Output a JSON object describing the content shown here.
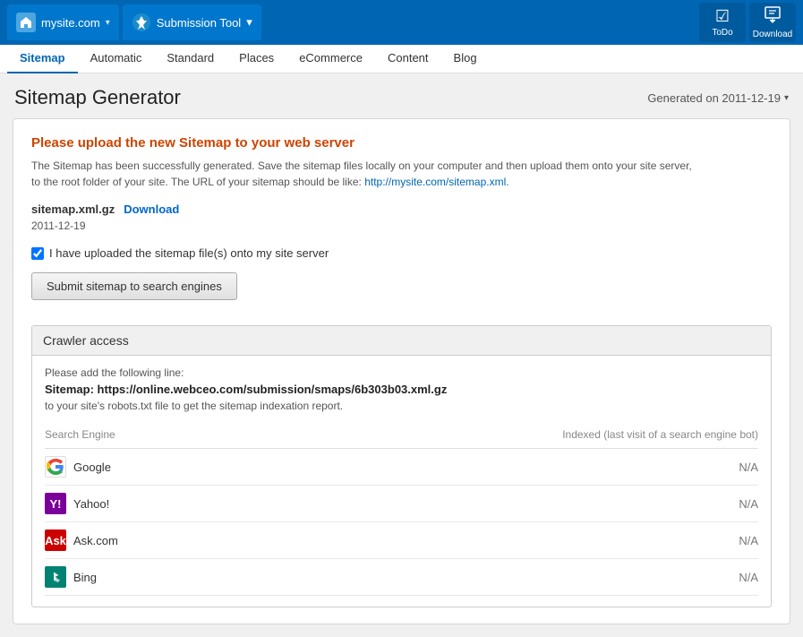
{
  "topbar": {
    "site": {
      "label": "mysite.com",
      "arrow": "▾"
    },
    "tool": {
      "label": "Submission Tool",
      "arrow": "▾"
    },
    "buttons": [
      {
        "id": "todo-btn",
        "label": "ToDo",
        "icon": "☑"
      },
      {
        "id": "download-btn",
        "label": "Download",
        "icon": "⬇"
      }
    ]
  },
  "secnav": {
    "tabs": [
      {
        "id": "sitemap",
        "label": "Sitemap",
        "active": true
      },
      {
        "id": "automatic",
        "label": "Automatic",
        "active": false
      },
      {
        "id": "standard",
        "label": "Standard",
        "active": false
      },
      {
        "id": "places",
        "label": "Places",
        "active": false
      },
      {
        "id": "ecommerce",
        "label": "eCommerce",
        "active": false
      },
      {
        "id": "content",
        "label": "Content",
        "active": false
      },
      {
        "id": "blog",
        "label": "Blog",
        "active": false
      }
    ]
  },
  "page": {
    "title": "Sitemap Generator",
    "generated": "Generated on 2011-12-19"
  },
  "alert": {
    "title": "Please upload the new Sitemap to your web server",
    "text1": "The Sitemap has been successfully generated. Save the sitemap files locally on your computer and then upload them onto your site server,",
    "text2": "to the root folder of your site. The URL of your sitemap should be like:",
    "link": "http://mysite.com/sitemap.xml",
    "linktext": "http://mysite.com/sitemap.xml."
  },
  "file": {
    "name": "sitemap.xml.gz",
    "download_label": "Download",
    "date": "2011-12-19"
  },
  "upload": {
    "checkbox_label": "I have uploaded the sitemap file(s) onto my site server",
    "checkbox_link": "my",
    "submit_label": "Submit sitemap to search engines"
  },
  "crawler": {
    "section_title": "Crawler access",
    "instruction": "Please add the following line:",
    "url_line": "Sitemap: https://online.webceo.com/submission/smaps/6b303b03.xml.gz",
    "suffix": "to your site's robots.txt file to get the sitemap indexation report.",
    "table_header_left": "Search Engine",
    "table_header_right": "Indexed (last visit of a search engine bot)",
    "engines": [
      {
        "id": "google",
        "name": "Google",
        "value": "N/A",
        "icon_type": "google"
      },
      {
        "id": "yahoo",
        "name": "Yahoo!",
        "value": "N/A",
        "icon_type": "yahoo"
      },
      {
        "id": "ask",
        "name": "Ask.com",
        "value": "N/A",
        "icon_type": "ask"
      },
      {
        "id": "bing",
        "name": "Bing",
        "value": "N/A",
        "icon_type": "bing"
      }
    ]
  }
}
